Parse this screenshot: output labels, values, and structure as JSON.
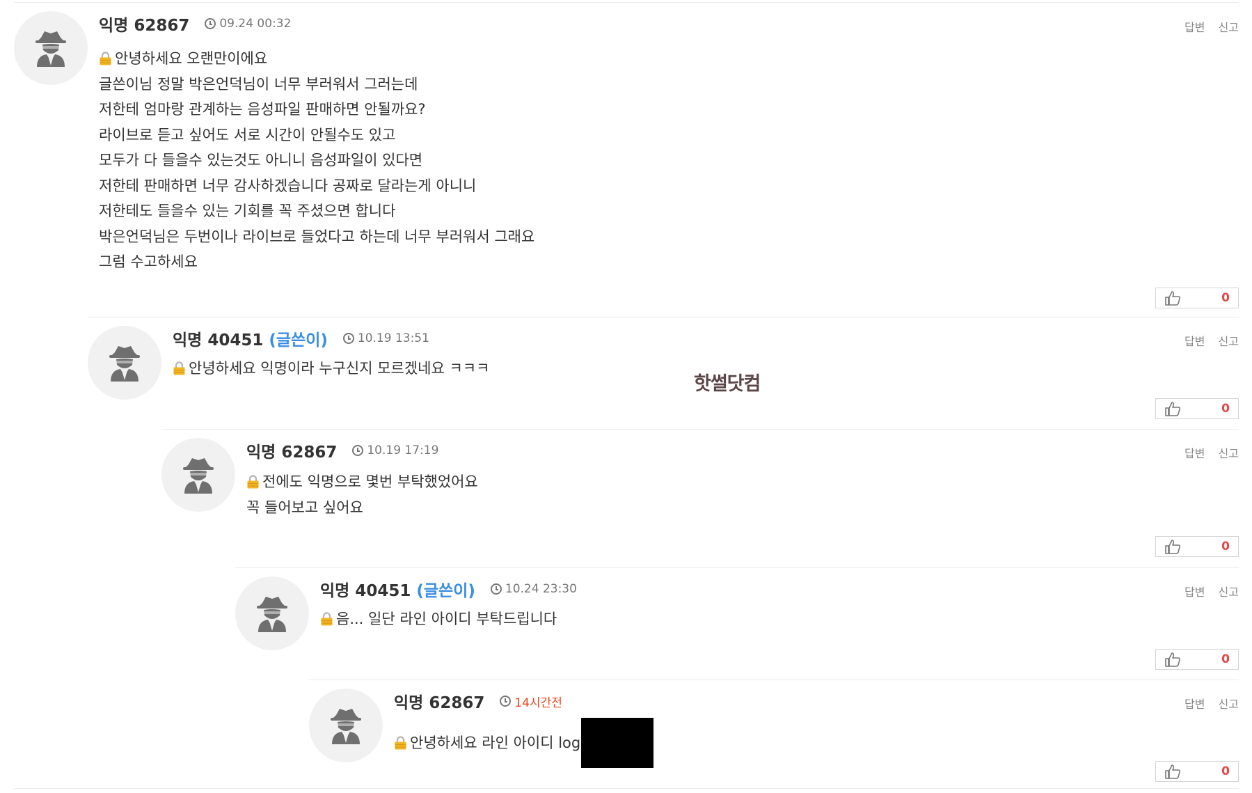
{
  "watermark": "핫썰닷컴",
  "comments": [
    {
      "author": "익명 62867",
      "op_tag": "",
      "timestamp": "09.24 00:32",
      "reply_label": "답변",
      "report_label": "신고",
      "lines": [
        "안녕하세요 오랜만이에요",
        "글쓴이님 정말 박은언덕님이 너무 부러워서 그러는데",
        "저한테 엄마랑 관계하는 음성파일 판매하면 안될까요?",
        "라이브로 듣고 싶어도 서로 시간이 안될수도 있고",
        "모두가 다 들을수 있는것도 아니니 음성파일이 있다면",
        "저한테 판매하면 너무 감사하겠습니다 공짜로 달라는게 아니니",
        "저한테도 들을수 있는 기회를 꼭 주셨으면 합니다",
        "박은언덕님은 두번이나 라이브로 들었다고 하는데 너무 부러워서 그래요",
        "그럼 수고하세요"
      ],
      "likes": "0"
    },
    {
      "author": "익명 40451",
      "op_tag": "(글쓴이)",
      "timestamp": "10.19 13:51",
      "reply_label": "답변",
      "report_label": "신고",
      "lines": [
        "안녕하세요 익명이라 누구신지 모르겠네요 ㅋㅋㅋ"
      ],
      "likes": "0"
    },
    {
      "author": "익명 62867",
      "op_tag": "",
      "timestamp": "10.19 17:19",
      "reply_label": "답변",
      "report_label": "신고",
      "lines": [
        "전에도 익명으로 몇번 부탁했었어요",
        "꼭 들어보고 싶어요"
      ],
      "likes": "0"
    },
    {
      "author": "익명 40451",
      "op_tag": "(글쓴이)",
      "timestamp": "10.24 23:30",
      "reply_label": "답변",
      "report_label": "신고",
      "lines": [
        "음... 일단 라인 아이디 부탁드립니다"
      ],
      "likes": "0"
    },
    {
      "author": "익명 62867",
      "op_tag": "",
      "timestamp": "14시간전",
      "reply_label": "답변",
      "report_label": "신고",
      "lines": [
        "안녕하세요 라인 아이디 log"
      ],
      "likes": "0"
    }
  ]
}
